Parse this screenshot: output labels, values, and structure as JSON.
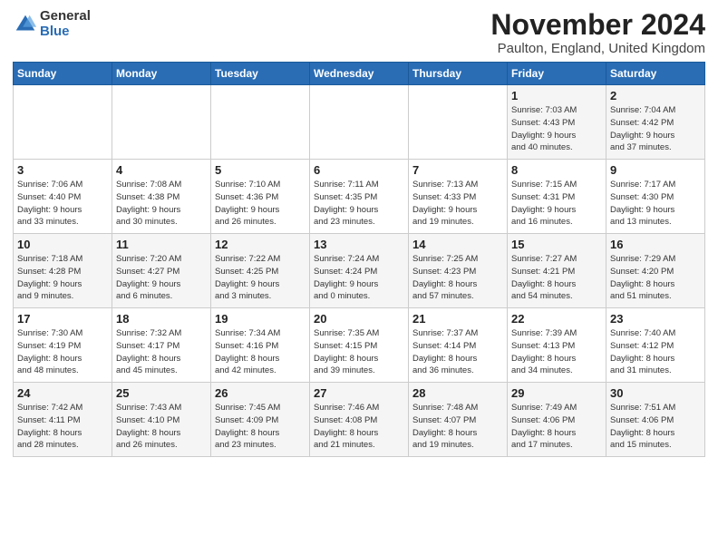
{
  "header": {
    "logo_general": "General",
    "logo_blue": "Blue",
    "month_title": "November 2024",
    "location": "Paulton, England, United Kingdom"
  },
  "days_of_week": [
    "Sunday",
    "Monday",
    "Tuesday",
    "Wednesday",
    "Thursday",
    "Friday",
    "Saturday"
  ],
  "weeks": [
    [
      {
        "day": "",
        "info": ""
      },
      {
        "day": "",
        "info": ""
      },
      {
        "day": "",
        "info": ""
      },
      {
        "day": "",
        "info": ""
      },
      {
        "day": "",
        "info": ""
      },
      {
        "day": "1",
        "info": "Sunrise: 7:03 AM\nSunset: 4:43 PM\nDaylight: 9 hours\nand 40 minutes."
      },
      {
        "day": "2",
        "info": "Sunrise: 7:04 AM\nSunset: 4:42 PM\nDaylight: 9 hours\nand 37 minutes."
      }
    ],
    [
      {
        "day": "3",
        "info": "Sunrise: 7:06 AM\nSunset: 4:40 PM\nDaylight: 9 hours\nand 33 minutes."
      },
      {
        "day": "4",
        "info": "Sunrise: 7:08 AM\nSunset: 4:38 PM\nDaylight: 9 hours\nand 30 minutes."
      },
      {
        "day": "5",
        "info": "Sunrise: 7:10 AM\nSunset: 4:36 PM\nDaylight: 9 hours\nand 26 minutes."
      },
      {
        "day": "6",
        "info": "Sunrise: 7:11 AM\nSunset: 4:35 PM\nDaylight: 9 hours\nand 23 minutes."
      },
      {
        "day": "7",
        "info": "Sunrise: 7:13 AM\nSunset: 4:33 PM\nDaylight: 9 hours\nand 19 minutes."
      },
      {
        "day": "8",
        "info": "Sunrise: 7:15 AM\nSunset: 4:31 PM\nDaylight: 9 hours\nand 16 minutes."
      },
      {
        "day": "9",
        "info": "Sunrise: 7:17 AM\nSunset: 4:30 PM\nDaylight: 9 hours\nand 13 minutes."
      }
    ],
    [
      {
        "day": "10",
        "info": "Sunrise: 7:18 AM\nSunset: 4:28 PM\nDaylight: 9 hours\nand 9 minutes."
      },
      {
        "day": "11",
        "info": "Sunrise: 7:20 AM\nSunset: 4:27 PM\nDaylight: 9 hours\nand 6 minutes."
      },
      {
        "day": "12",
        "info": "Sunrise: 7:22 AM\nSunset: 4:25 PM\nDaylight: 9 hours\nand 3 minutes."
      },
      {
        "day": "13",
        "info": "Sunrise: 7:24 AM\nSunset: 4:24 PM\nDaylight: 9 hours\nand 0 minutes."
      },
      {
        "day": "14",
        "info": "Sunrise: 7:25 AM\nSunset: 4:23 PM\nDaylight: 8 hours\nand 57 minutes."
      },
      {
        "day": "15",
        "info": "Sunrise: 7:27 AM\nSunset: 4:21 PM\nDaylight: 8 hours\nand 54 minutes."
      },
      {
        "day": "16",
        "info": "Sunrise: 7:29 AM\nSunset: 4:20 PM\nDaylight: 8 hours\nand 51 minutes."
      }
    ],
    [
      {
        "day": "17",
        "info": "Sunrise: 7:30 AM\nSunset: 4:19 PM\nDaylight: 8 hours\nand 48 minutes."
      },
      {
        "day": "18",
        "info": "Sunrise: 7:32 AM\nSunset: 4:17 PM\nDaylight: 8 hours\nand 45 minutes."
      },
      {
        "day": "19",
        "info": "Sunrise: 7:34 AM\nSunset: 4:16 PM\nDaylight: 8 hours\nand 42 minutes."
      },
      {
        "day": "20",
        "info": "Sunrise: 7:35 AM\nSunset: 4:15 PM\nDaylight: 8 hours\nand 39 minutes."
      },
      {
        "day": "21",
        "info": "Sunrise: 7:37 AM\nSunset: 4:14 PM\nDaylight: 8 hours\nand 36 minutes."
      },
      {
        "day": "22",
        "info": "Sunrise: 7:39 AM\nSunset: 4:13 PM\nDaylight: 8 hours\nand 34 minutes."
      },
      {
        "day": "23",
        "info": "Sunrise: 7:40 AM\nSunset: 4:12 PM\nDaylight: 8 hours\nand 31 minutes."
      }
    ],
    [
      {
        "day": "24",
        "info": "Sunrise: 7:42 AM\nSunset: 4:11 PM\nDaylight: 8 hours\nand 28 minutes."
      },
      {
        "day": "25",
        "info": "Sunrise: 7:43 AM\nSunset: 4:10 PM\nDaylight: 8 hours\nand 26 minutes."
      },
      {
        "day": "26",
        "info": "Sunrise: 7:45 AM\nSunset: 4:09 PM\nDaylight: 8 hours\nand 23 minutes."
      },
      {
        "day": "27",
        "info": "Sunrise: 7:46 AM\nSunset: 4:08 PM\nDaylight: 8 hours\nand 21 minutes."
      },
      {
        "day": "28",
        "info": "Sunrise: 7:48 AM\nSunset: 4:07 PM\nDaylight: 8 hours\nand 19 minutes."
      },
      {
        "day": "29",
        "info": "Sunrise: 7:49 AM\nSunset: 4:06 PM\nDaylight: 8 hours\nand 17 minutes."
      },
      {
        "day": "30",
        "info": "Sunrise: 7:51 AM\nSunset: 4:06 PM\nDaylight: 8 hours\nand 15 minutes."
      }
    ]
  ]
}
